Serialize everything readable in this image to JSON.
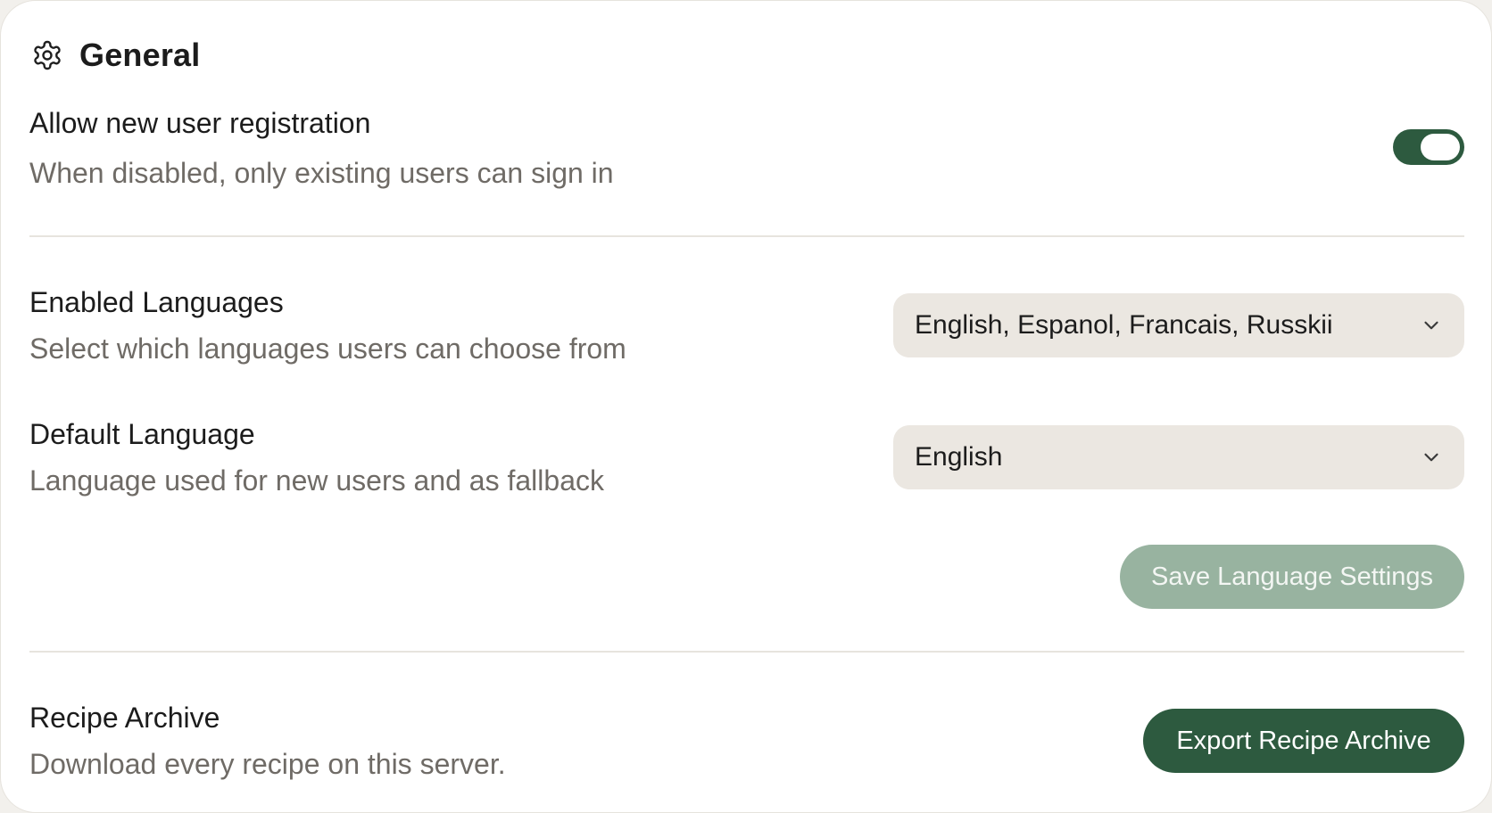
{
  "section": {
    "title": "General",
    "icon": "gear-icon"
  },
  "registration": {
    "label": "Allow new user registration",
    "description": "When disabled, only existing users can sign in",
    "enabled": true
  },
  "languages": {
    "enabled_label": "Enabled Languages",
    "enabled_description": "Select which languages users can choose from",
    "enabled_value": "English, Espanol, Francais, Russkii",
    "default_label": "Default Language",
    "default_description": "Language used for new users and as fallback",
    "default_value": "English",
    "save_button": "Save Language Settings"
  },
  "archive": {
    "label": "Recipe Archive",
    "description": "Download every recipe on this server.",
    "export_button": "Export Recipe Archive"
  },
  "colors": {
    "accent": "#2d5a3f",
    "accent_disabled": "#98b3a0",
    "select_bg": "#ebe7e1",
    "muted_text": "#6f6b66"
  }
}
